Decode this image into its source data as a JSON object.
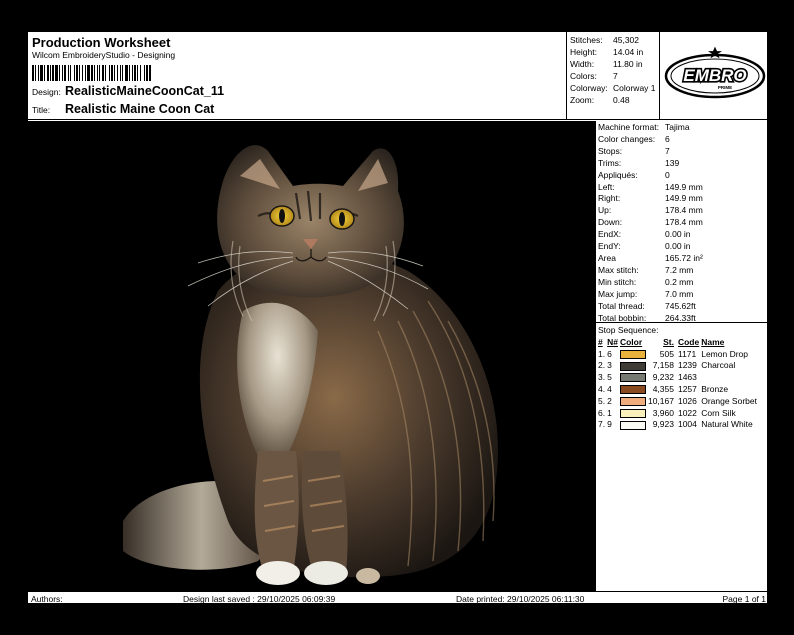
{
  "header": {
    "title": "Production Worksheet",
    "subtitle": "Wilcom EmbroideryStudio - Designing",
    "design_label": "Design:",
    "design_value": "RealisticMaineCoonCat_11",
    "title_label": "Title:",
    "title_value": "Realistic Maine Coon Cat"
  },
  "summary": [
    {
      "k": "Stitches:",
      "v": "45,302"
    },
    {
      "k": "Height:",
      "v": "14.04 in"
    },
    {
      "k": "Width:",
      "v": "11.80 in"
    },
    {
      "k": "Colors:",
      "v": "7"
    },
    {
      "k": "Colorway:",
      "v": "Colorway 1"
    },
    {
      "k": "Zoom:",
      "v": "0.48"
    }
  ],
  "logo": {
    "text": "EMBRO",
    "subtext": "PRIME"
  },
  "params": [
    {
      "k": "Machine format:",
      "v": "Tajima"
    },
    {
      "k": "Color changes:",
      "v": "6"
    },
    {
      "k": "Stops:",
      "v": "7"
    },
    {
      "k": "Trims:",
      "v": "139"
    },
    {
      "k": "Appliqués:",
      "v": "0"
    },
    {
      "k": "Left:",
      "v": "149.9 mm"
    },
    {
      "k": "Right:",
      "v": "149.9 mm"
    },
    {
      "k": "Up:",
      "v": "178.4 mm"
    },
    {
      "k": "Down:",
      "v": "178.4 mm"
    },
    {
      "k": "EndX:",
      "v": "0.00 in"
    },
    {
      "k": "EndY:",
      "v": "0.00 in"
    },
    {
      "k": "Area",
      "v": "165.72 in²"
    },
    {
      "k": "Max stitch:",
      "v": "7.2 mm"
    },
    {
      "k": "Min stitch:",
      "v": "0.2 mm"
    },
    {
      "k": "Max jump:",
      "v": "7.0 mm"
    },
    {
      "k": "Total thread:",
      "v": "745.62ft"
    },
    {
      "k": "Total bobbin:",
      "v": "264.33ft"
    }
  ],
  "stops": {
    "heading": "Stop Sequence:",
    "columns": [
      "#",
      "N#",
      "Color",
      "St.",
      "Code",
      "Name"
    ],
    "rows": [
      {
        "n": "1.",
        "nn": "6",
        "color": "#e9b23a",
        "st": "505",
        "code": "1171",
        "name": "Lemon Drop"
      },
      {
        "n": "2.",
        "nn": "3",
        "color": "#3f3c38",
        "st": "7,158",
        "code": "1239",
        "name": "Charcoal"
      },
      {
        "n": "3.",
        "nn": "5",
        "color": "#777a73",
        "st": "9,232",
        "code": "1463",
        "name": ""
      },
      {
        "n": "4.",
        "nn": "4",
        "color": "#8a4a1f",
        "st": "4,355",
        "code": "1257",
        "name": "Bronze"
      },
      {
        "n": "5.",
        "nn": "2",
        "color": "#efac7c",
        "st": "10,167",
        "code": "1026",
        "name": "Orange Sorbet"
      },
      {
        "n": "6.",
        "nn": "1",
        "color": "#faf0bc",
        "st": "3,960",
        "code": "1022",
        "name": "Corn Silk"
      },
      {
        "n": "7.",
        "nn": "9",
        "color": "#fbfbf6",
        "st": "9,923",
        "code": "1004",
        "name": "Natural White"
      }
    ]
  },
  "footer": {
    "authors": "Authors:",
    "saved": "Design last saved : 29/10/2025 06:09:39",
    "printed": "Date printed: 29/10/2025 06:11:30",
    "page": "Page 1 of 1"
  }
}
